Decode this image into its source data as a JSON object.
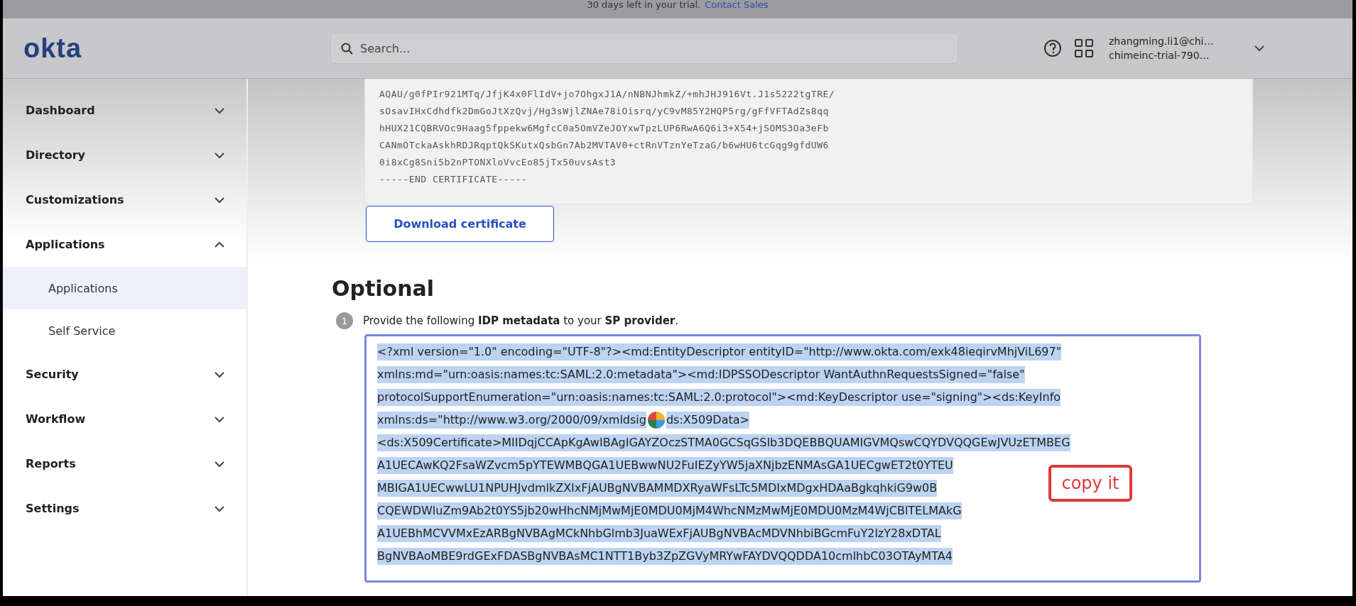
{
  "banner": {
    "text": "30 days left in your trial.",
    "link": "Contact Sales"
  },
  "header": {
    "logo": "okta",
    "search": {
      "placeholder": "Search..."
    },
    "user": {
      "name": "zhangming.li1@chi…",
      "org": "chimeinc-trial-790…"
    }
  },
  "sidebar": {
    "items": [
      {
        "label": "Dashboard",
        "expanded": false
      },
      {
        "label": "Directory",
        "expanded": false
      },
      {
        "label": "Customizations",
        "expanded": false
      },
      {
        "label": "Applications",
        "expanded": true,
        "children": [
          {
            "label": "Applications",
            "selected": true
          },
          {
            "label": "Self Service",
            "selected": false
          }
        ]
      },
      {
        "label": "Security",
        "expanded": false
      },
      {
        "label": "Workflow",
        "expanded": false
      },
      {
        "label": "Reports",
        "expanded": false
      },
      {
        "label": "Settings",
        "expanded": false
      }
    ]
  },
  "certificate": {
    "lines": [
      "AQAU/g0fPIr921MTq/JfjK4x0FlIdV+jo7OhgxJ1A/nNBNJhmkZ/+mhJHJ916Vt.J1s5222tgTRE/",
      "sOsavIHxCdhdfk2DmGoJtXzQvj/Hg3sWjlZNAe78iOisrq/yC9vM85Y2HQP5rg/gFfVFTAdZs8qq",
      "hHUX21CQBRVOc9Haag5fppekw6MgfcC0a5OmVZeJOYxwTpzLUP6RwA6Q6i3+X54+jSOMS3Oa3eFb",
      "CANmOTckaAskhRDJRqptQkSKutxQsbGn7Ab2MVTAV0+ctRnVTznYeTzaG/b6wHU6tcGqg9gfdUW6",
      "0i8xCg8Sni5b2nPTONXloVvcEo85jTx50uvsAst3",
      "-----END CERTIFICATE-----"
    ],
    "button": "Download certificate"
  },
  "optional": {
    "title": "Optional",
    "step": {
      "number": "1",
      "text": "Provide the following **IDP metadata** to your **SP provider**."
    },
    "metadata": {
      "selected": true,
      "lines": [
        {
          "segments": [
            "<?xml version=\"1.0\" encoding=\"UTF-8\"?><md:EntityDescriptor entityID=\"http://www.okta.com/exk48ieqirvMhjViL697\""
          ]
        },
        {
          "segments": [
            "xmlns:md=\"urn:oasis:names:tc:SAML:2.0:metadata\"><md:IDPSSODescriptor WantAuthnRequestsSigned=\"false\""
          ]
        },
        {
          "segments": [
            "protocolSupportEnumeration=\"urn:oasis:names:tc:SAML:2.0:protocol\"><md:KeyDescriptor use=\"signing\"><ds:KeyInfo"
          ]
        },
        {
          "segments": [
            "xmlns:ds=\"http://www.w3.org/2000/09/xmldsig",
            "ds:X509Data>"
          ]
        },
        {
          "segments": [
            "<ds:X509Certificate>MIIDqjCCApKgAwIBAgIGAYZOczSTMA0GCSqGSIb3DQEBBQUAMIGVMQswCQYDVQQGEwJVUzETMBEG"
          ]
        },
        {
          "segments": [
            "A1UECAwKQ2FsaWZvcm5pYTEWMBQGA1UEBwwNU2FuIEZyYW5jaXNjbzENMAsGA1UECgwET2t0YTEU"
          ]
        },
        {
          "segments": [
            "MBIGA1UECwwLU1NPUHJvdmlkZXIxFjAUBgNVBAMMDXRyaWFsLTc5MDIxMDgxHDAaBgkqhkiG9w0B"
          ]
        },
        {
          "segments": [
            "CQEWDWluZm9Ab2t0YS5jb20wHhcNMjMwMjE0MDU0MjM4WhcNMzMwMjE0MDU0MzM4WjCBlTELMAkG"
          ]
        },
        {
          "segments": [
            "A1UEBhMCVVMxEzARBgNVBAgMCkNhbGlmb3JuaWExFjAUBgNVBAcMDVNhbiBGcmFuY2lzY28xDTAL"
          ]
        },
        {
          "segments": [
            "BgNVBAoMBE9rdGExFDASBgNVBAsMC1NTT1Byb3ZpZGVyMRYwFAYDVQQDDA10cmlhbC03OTAyMTA4"
          ]
        }
      ]
    }
  },
  "annotation": {
    "text": "copy it"
  }
}
